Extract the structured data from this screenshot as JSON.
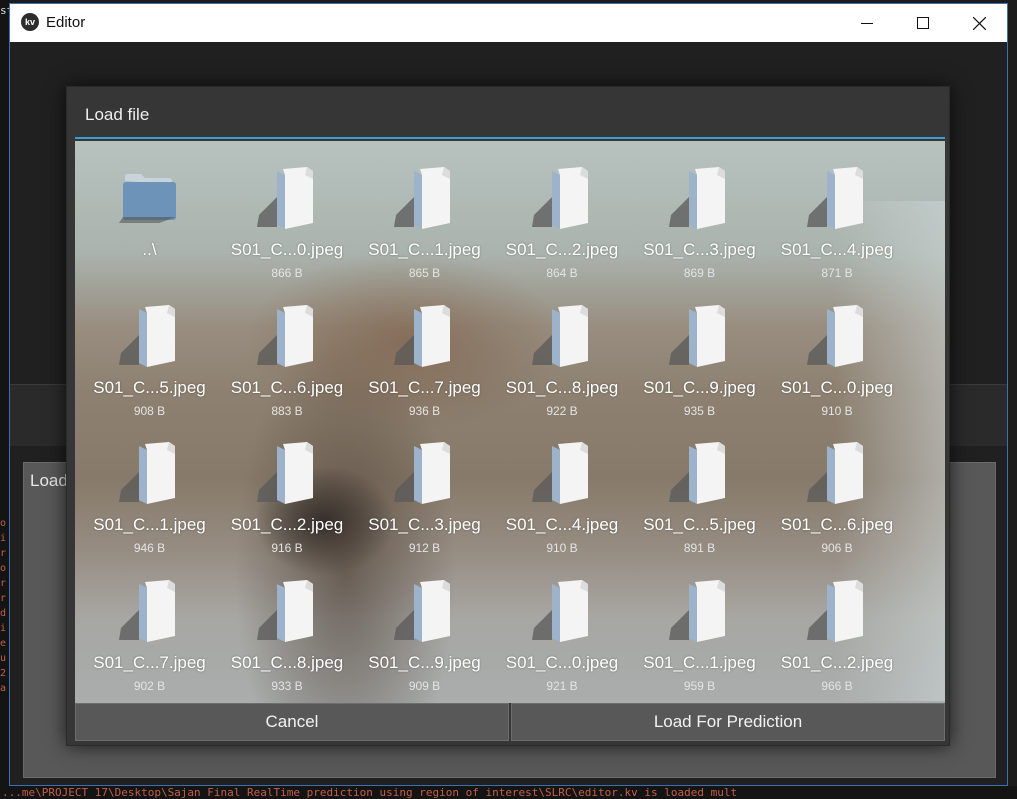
{
  "window": {
    "title": "Editor"
  },
  "background": {
    "panel_label": "Load",
    "terminal_left": [
      "o",
      "i",
      "r",
      "o",
      "r",
      "r",
      "d",
      "i",
      "e",
      "u",
      "2",
      "a"
    ],
    "terminal_bottom": "...me\\PROJECT 17\\Desktop\\Sajan Final RealTime prediction using region of interest\\SLRC\\editor.kv is loaded mult",
    "terminal_top_glyph": "st"
  },
  "popup": {
    "title": "Load file",
    "files": [
      {
        "name": "..\\",
        "size": "",
        "type": "folder"
      },
      {
        "name": "S01_C...0.jpeg",
        "size": "866 B",
        "type": "file"
      },
      {
        "name": "S01_C...1.jpeg",
        "size": "865 B",
        "type": "file"
      },
      {
        "name": "S01_C...2.jpeg",
        "size": "864 B",
        "type": "file"
      },
      {
        "name": "S01_C...3.jpeg",
        "size": "869 B",
        "type": "file"
      },
      {
        "name": "S01_C...4.jpeg",
        "size": "871 B",
        "type": "file"
      },
      {
        "name": "S01_C...5.jpeg",
        "size": "908 B",
        "type": "file"
      },
      {
        "name": "S01_C...6.jpeg",
        "size": "883 B",
        "type": "file"
      },
      {
        "name": "S01_C...7.jpeg",
        "size": "936 B",
        "type": "file"
      },
      {
        "name": "S01_C...8.jpeg",
        "size": "922 B",
        "type": "file"
      },
      {
        "name": "S01_C...9.jpeg",
        "size": "935 B",
        "type": "file"
      },
      {
        "name": "S01_C...0.jpeg",
        "size": "910 B",
        "type": "file"
      },
      {
        "name": "S01_C...1.jpeg",
        "size": "946 B",
        "type": "file"
      },
      {
        "name": "S01_C...2.jpeg",
        "size": "916 B",
        "type": "file"
      },
      {
        "name": "S01_C...3.jpeg",
        "size": "912 B",
        "type": "file"
      },
      {
        "name": "S01_C...4.jpeg",
        "size": "910 B",
        "type": "file"
      },
      {
        "name": "S01_C...5.jpeg",
        "size": "891 B",
        "type": "file"
      },
      {
        "name": "S01_C...6.jpeg",
        "size": "906 B",
        "type": "file"
      },
      {
        "name": "S01_C...7.jpeg",
        "size": "902 B",
        "type": "file"
      },
      {
        "name": "S01_C...8.jpeg",
        "size": "933 B",
        "type": "file"
      },
      {
        "name": "S01_C...9.jpeg",
        "size": "909 B",
        "type": "file"
      },
      {
        "name": "S01_C...0.jpeg",
        "size": "921 B",
        "type": "file"
      },
      {
        "name": "S01_C...1.jpeg",
        "size": "959 B",
        "type": "file"
      },
      {
        "name": "S01_C...2.jpeg",
        "size": "966 B",
        "type": "file"
      }
    ],
    "cancel_label": "Cancel",
    "load_label": "Load For Prediction"
  },
  "icons": {
    "app": "kivy-logo-icon",
    "folder": "folder-icon",
    "file": "file-icon"
  },
  "colors": {
    "accent": "#3a9fd0",
    "popup_bg": "#363636",
    "button_bg": "#585858"
  }
}
